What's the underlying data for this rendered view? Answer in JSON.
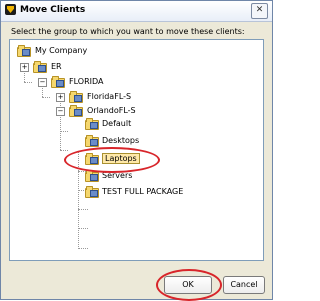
{
  "window": {
    "title": "Move Clients",
    "close_glyph": "✕"
  },
  "instruction": "Select the group to which you want to move these clients:",
  "tree": {
    "nodes": [
      {
        "label": "My Company",
        "expander": "",
        "level": 0
      },
      {
        "label": "ER",
        "expander": "+",
        "level": 1
      },
      {
        "label": "FLORIDA",
        "expander": "−",
        "level": 2
      },
      {
        "label": "FloridaFL-S",
        "expander": "+",
        "level": 3
      },
      {
        "label": "OrlandoFL-S",
        "expander": "−",
        "level": 3
      },
      {
        "label": "Default",
        "expander": "",
        "level": 4
      },
      {
        "label": "Desktops",
        "expander": "",
        "level": 4
      },
      {
        "label": "Laptops",
        "expander": "",
        "level": 4,
        "selected": true
      },
      {
        "label": "Servers",
        "expander": "",
        "level": 4
      },
      {
        "label": "TEST FULL PACKAGE",
        "expander": "",
        "level": 4
      }
    ]
  },
  "buttons": {
    "ok": "OK",
    "cancel": "Cancel"
  },
  "colors": {
    "highlight_ring": "#d8252a",
    "selection_fill": "#ffe9a8",
    "folder": "#f5d76e"
  },
  "icons": {
    "app": "shield-icon",
    "folder": "folder-group-icon",
    "close": "close-icon"
  }
}
